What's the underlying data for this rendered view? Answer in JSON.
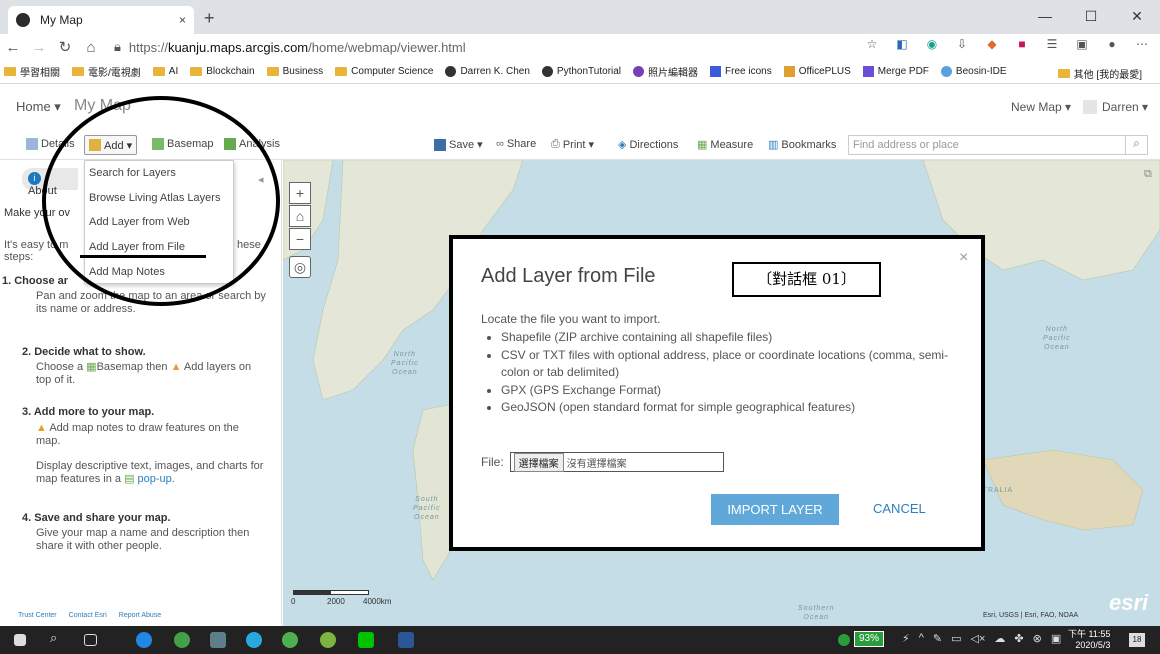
{
  "browser": {
    "tab_title": "My Map",
    "tab_close": "×",
    "new_tab": "+",
    "url_scheme": "https://",
    "url_host": "kuanju.maps.arcgis.com",
    "url_path": "/home/webmap/viewer.html",
    "window_controls": [
      "—",
      "☐",
      "✕"
    ],
    "bookmarks": [
      "學習相關",
      "電影/電視劇",
      "AI",
      "Blockchain",
      "Business",
      "Computer Science",
      "Darren K. Chen",
      "PythonTutorial",
      "照片編輯器",
      "Free icons",
      "OfficePLUS",
      "Merge PDF",
      "Beosin-IDE"
    ],
    "bookmarks_other": "其他 [我的最愛]"
  },
  "app": {
    "home": "Home ▾",
    "map_title": "My Map",
    "new_map": "New Map ▾",
    "user": "Darren ▾"
  },
  "toolbar": {
    "details": "Details",
    "add": "Add ▾",
    "basemap": "Basemap",
    "analysis": "Analysis",
    "save": "Save ▾",
    "share": "Share",
    "print": "Print ▾",
    "directions": "Directions",
    "measure": "Measure",
    "bookmarks": "Bookmarks",
    "find_placeholder": "Find address or place"
  },
  "add_menu": [
    "Search for Layers",
    "Browse Living Atlas Layers",
    "Add Layer from Web",
    "Add Layer from File",
    "Add Map Notes"
  ],
  "panel": {
    "about_tab": "About",
    "intro1": "Make your ov",
    "intro2": "It's easy to m",
    "intro2b": "hese",
    "intro3": "steps:",
    "s1_title": "1. Choose ar",
    "s1_text1": "Pan and zoom the map to an area or search by",
    "s1_text2": "its name or address.",
    "s2_title": "2. Decide what to show.",
    "s2_text1a": "Choose a",
    "s2_text1b": "Basemap then",
    "s2_text1c": "Add layers on",
    "s2_text2": "top of it.",
    "s3_title": "3. Add more to your map.",
    "s3_text1": "Add map notes to draw features on the",
    "s3_text2": "map.",
    "s3_text3": "Display descriptive text, images, and charts for",
    "s3_text4a": "map features in a",
    "s3_text4b": "pop-up.",
    "s4_title": "4. Save and share your map.",
    "s4_text1": "Give your map a name and description then",
    "s4_text2": "share it with other people.",
    "footer": [
      "Trust Center",
      "Contact Esri",
      "Report Abuse"
    ]
  },
  "map": {
    "ocean_labels": [
      "North\nPacific\nOcean",
      "North\nPacific\nOcean",
      "South\nPacific\nOcean",
      "Southern\nOcean"
    ],
    "australia": "STRALIA",
    "scale_0": "0",
    "scale_2000": "2000",
    "scale_4000": "4000km",
    "attribution": "Esri, USGS | Esri, FAO, NOAA",
    "esri_logo": "esri"
  },
  "dialog": {
    "title": "Add Layer from File",
    "annotation_label": "〔對話框 01〕",
    "subtitle": "Locate the file you want to import.",
    "formats": [
      "Shapefile (ZIP archive containing all shapefile files)",
      "CSV or TXT files with optional address, place or coordinate locations (comma, semi-colon or tab delimited)",
      "GPX (GPS Exchange Format)",
      "GeoJSON (open standard format for simple geographical features)"
    ],
    "file_label": "File:",
    "choose_file": "選擇檔案",
    "no_file": "沒有選擇檔案",
    "import_button": "IMPORT LAYER",
    "cancel_button": "CANCEL",
    "close": "×"
  },
  "taskbar": {
    "battery": "93%",
    "time": "下午 11:55",
    "date": "2020/5/3",
    "notif": "18"
  }
}
